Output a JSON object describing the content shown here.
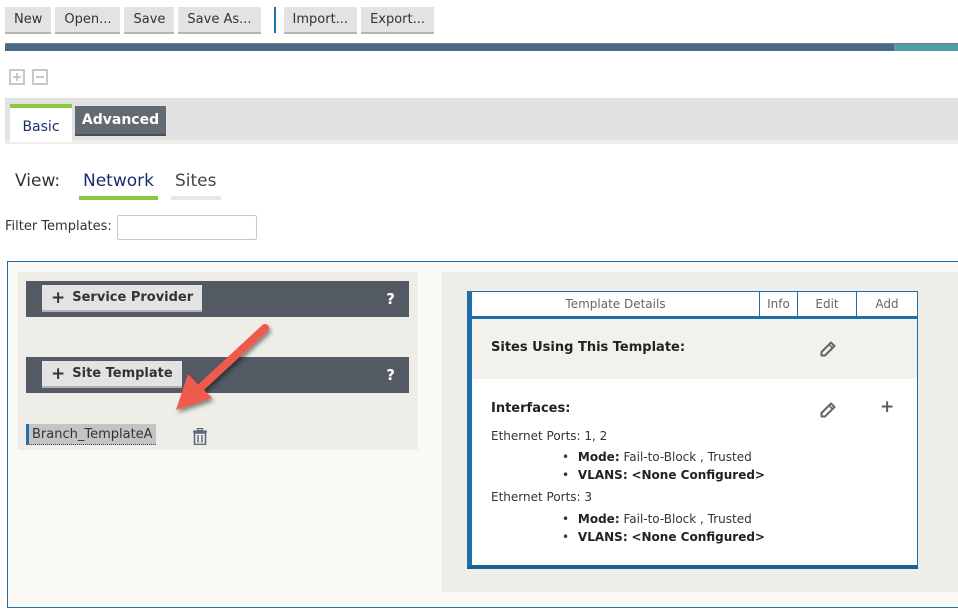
{
  "toolbar": {
    "new": "New",
    "open": "Open...",
    "save": "Save",
    "save_as": "Save As...",
    "import": "Import...",
    "export": "Export..."
  },
  "progress": {
    "value_fraction": 0.93
  },
  "expand_controls": {
    "expand": "expand-all",
    "collapse": "collapse-all"
  },
  "mode_tabs": {
    "basic": "Basic",
    "advanced": "Advanced",
    "active": "Basic"
  },
  "view": {
    "label": "View:",
    "network": "Network",
    "sites": "Sites",
    "active": "Network"
  },
  "filter": {
    "label": "Filter Templates:",
    "value": "",
    "placeholder": ""
  },
  "left": {
    "service_provider_button": "Service Provider",
    "site_template_button": "Site Template",
    "help": "?",
    "templates": [
      "Branch_TemplateA"
    ]
  },
  "details": {
    "header": {
      "title": "Template Details",
      "info": "Info",
      "edit": "Edit",
      "add": "Add"
    },
    "sites_using_title": "Sites Using This Template:",
    "interfaces_title": "Interfaces:",
    "interfaces": [
      {
        "ports": "Ethernet Ports: 1, 2",
        "mode_label": "Mode:",
        "mode_value": "Fail-to-Block , Trusted",
        "vlans_label": "VLANS:",
        "vlans_value": "<None Configured>"
      },
      {
        "ports": "Ethernet Ports: 3",
        "mode_label": "Mode:",
        "mode_value": "Fail-to-Block , Trusted",
        "vlans_label": "VLANS:",
        "vlans_value": "<None Configured>"
      }
    ]
  },
  "colors": {
    "accent_blue": "#1f6fa8",
    "accent_green": "#8cc63f",
    "section_bar": "#535a63",
    "arrow": "#ee5a4e"
  }
}
